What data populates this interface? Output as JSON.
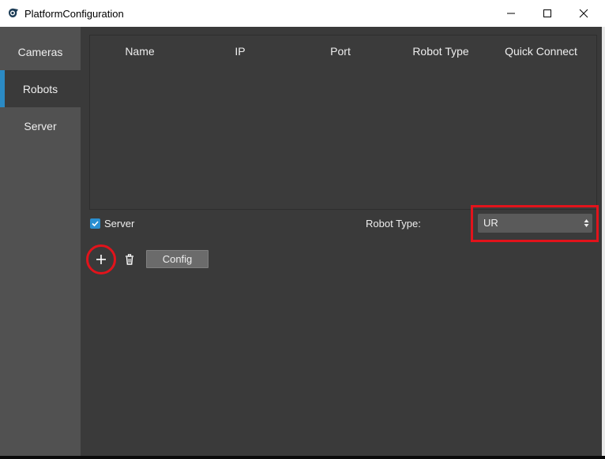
{
  "window": {
    "title": "PlatformConfiguration"
  },
  "sidebar": {
    "items": [
      {
        "label": "Cameras",
        "active": false
      },
      {
        "label": "Robots",
        "active": true
      },
      {
        "label": "Server",
        "active": false
      }
    ]
  },
  "table": {
    "columns": [
      "Name",
      "IP",
      "Port",
      "Robot Type",
      "Quick Connect"
    ],
    "rows": []
  },
  "options": {
    "server_checkbox_label": "Server",
    "server_checked": true,
    "robot_type_label": "Robot Type:",
    "robot_type_value": "UR"
  },
  "toolbar": {
    "config_label": "Config"
  },
  "colors": {
    "accent": "#2b8ac4",
    "highlight": "#e2131b",
    "background": "#3a3a3a",
    "sidebar": "#515151"
  }
}
